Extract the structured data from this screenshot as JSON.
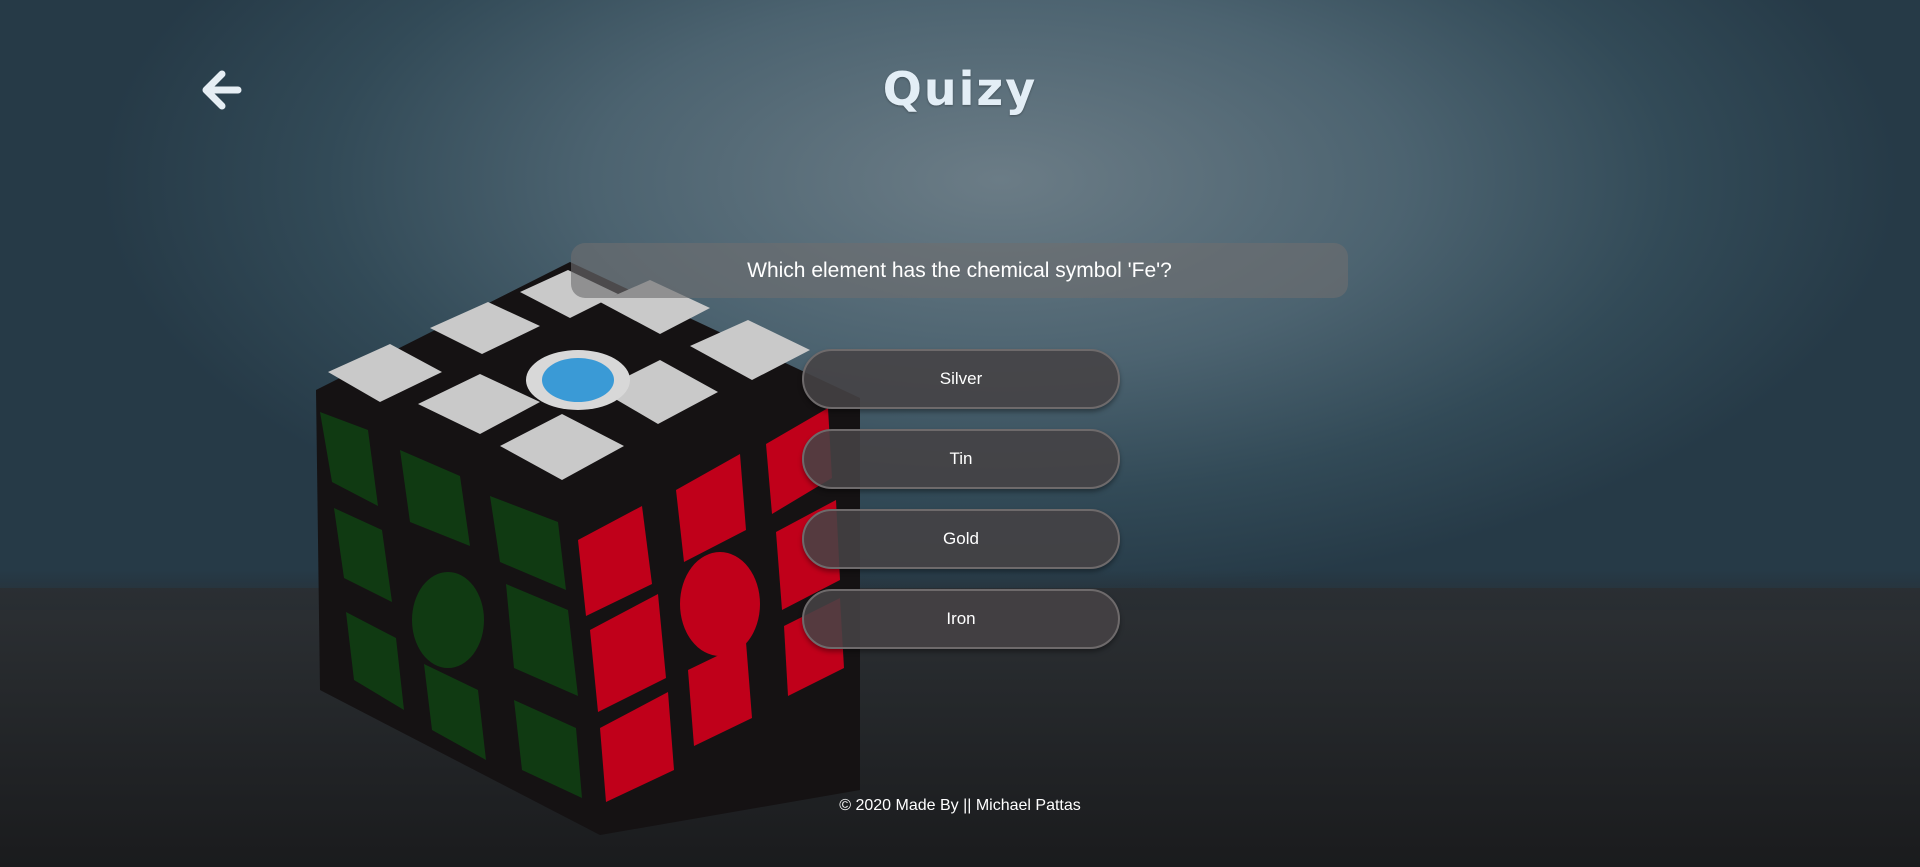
{
  "header": {
    "back_icon": "arrow-left-icon",
    "title": "Quizy"
  },
  "quiz": {
    "question": "Which element has the chemical symbol 'Fe'?",
    "answers": [
      {
        "label": "Silver"
      },
      {
        "label": "Tin"
      },
      {
        "label": "Gold"
      },
      {
        "label": "Iron"
      }
    ]
  },
  "footer": {
    "text": "© 2020 Made By || Michael Pattas"
  },
  "colors": {
    "cube_white": "#c9c9c9",
    "cube_red": "#c0001a",
    "cube_green": "#103a12",
    "logo_blue": "#1e8fd6"
  },
  "background_image": {
    "subject": "rubiks-cube-photo"
  }
}
